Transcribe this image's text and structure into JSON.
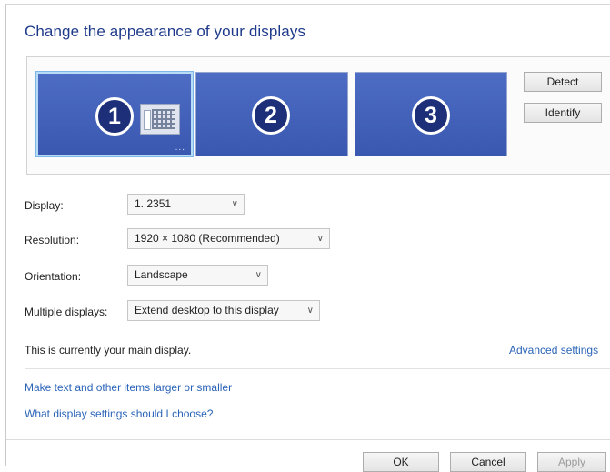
{
  "header": {
    "title": "Change the appearance of your displays"
  },
  "monitors": [
    {
      "number": "1",
      "selected": true
    },
    {
      "number": "2",
      "selected": false
    },
    {
      "number": "3",
      "selected": false
    }
  ],
  "monitor_dots": "...",
  "buttons": {
    "detect": "Detect",
    "identify": "Identify"
  },
  "fields": {
    "display": {
      "label": "Display:",
      "value": "1. 2351"
    },
    "resolution": {
      "label": "Resolution:",
      "value": "1920 × 1080 (Recommended)"
    },
    "orientation": {
      "label": "Orientation:",
      "value": "Landscape"
    },
    "multiple": {
      "label": "Multiple displays:",
      "value": "Extend desktop to this display"
    }
  },
  "status": "This is currently your main display.",
  "links": {
    "advanced": "Advanced settings",
    "larger": "Make text and other items larger or smaller",
    "which": "What display settings should I choose?"
  },
  "footer": {
    "ok": "OK",
    "cancel": "Cancel",
    "apply": "Apply"
  },
  "icons": {
    "chevron": "chevron-down-icon",
    "taskbar": "start-screen-icon"
  },
  "colors": {
    "title": "#1e3a8a",
    "monitor": "#3a58b0",
    "link": "#2a64b8"
  }
}
